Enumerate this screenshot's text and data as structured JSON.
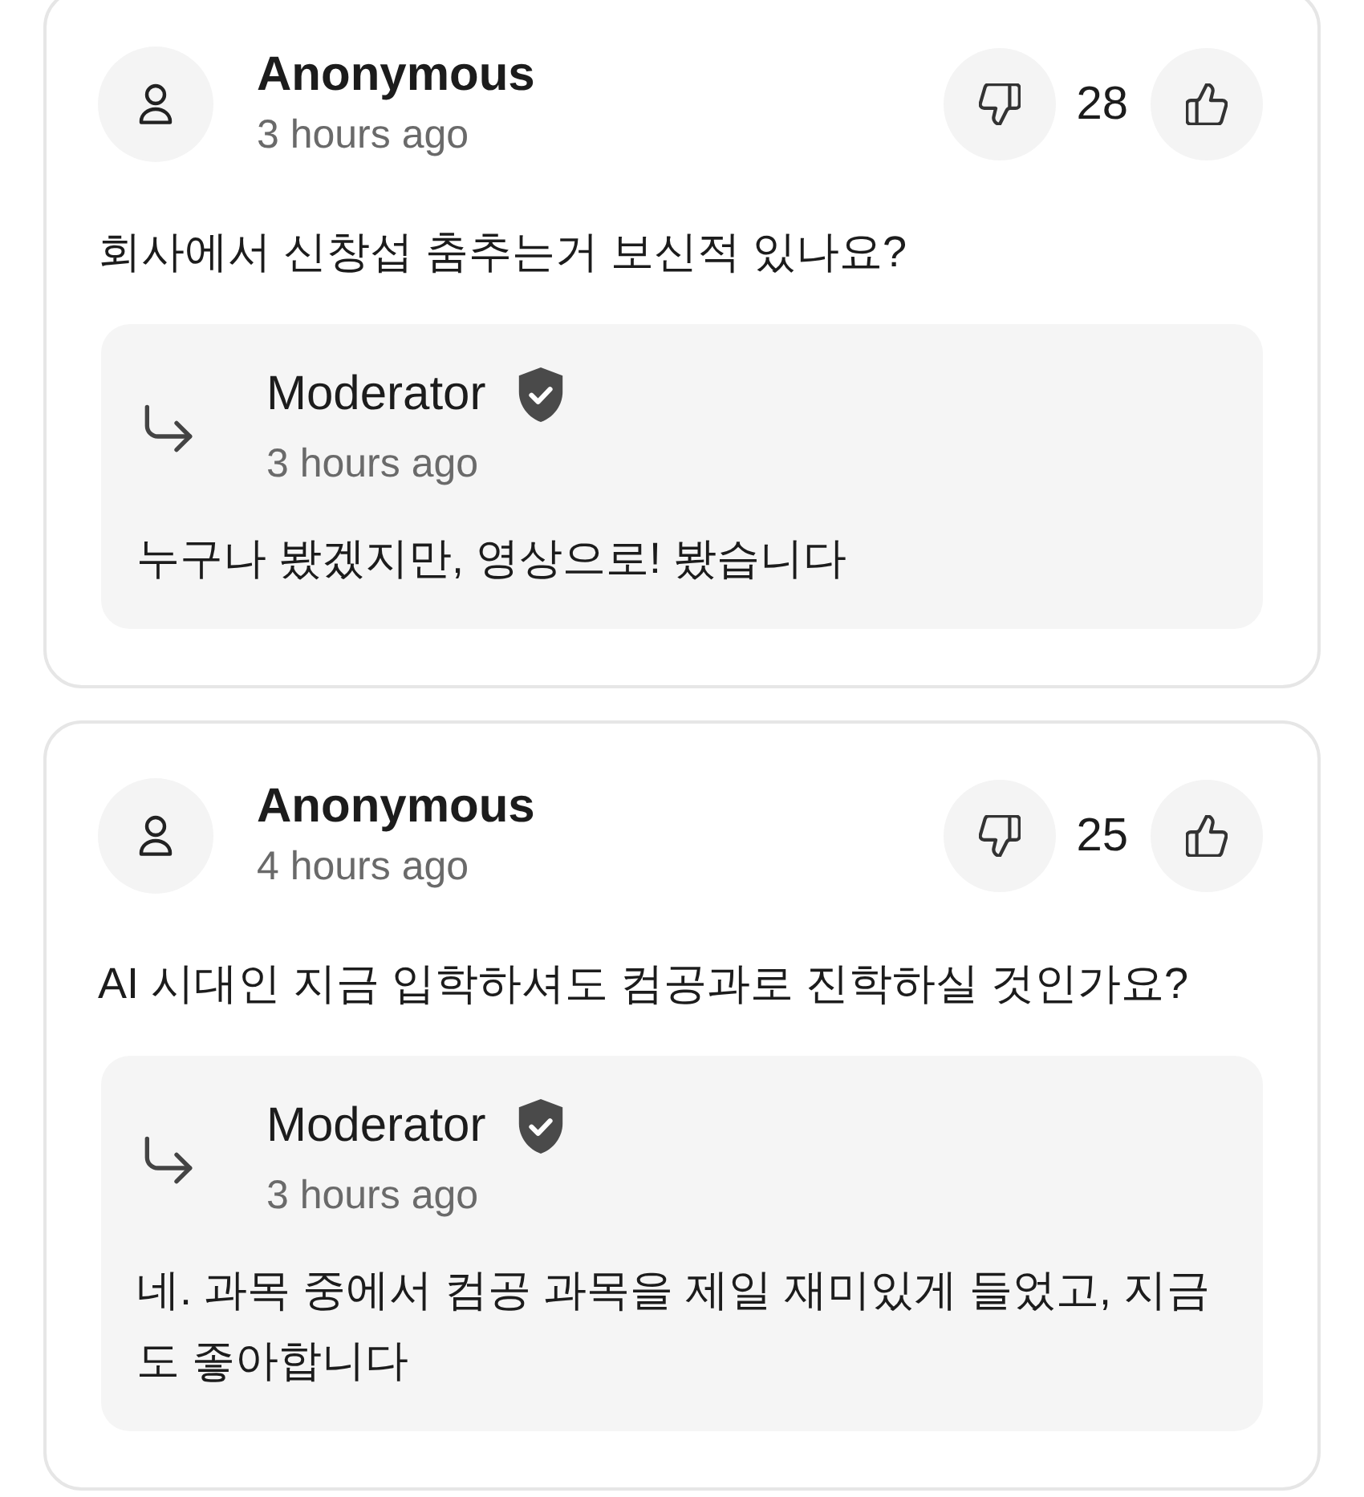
{
  "comments": [
    {
      "author": "Anonymous",
      "time": "3 hours ago",
      "score": "28",
      "text": "회사에서 신창섭 춤추는거 보신적 있나요?",
      "reply": {
        "author": "Moderator",
        "verified": true,
        "time": "3 hours ago",
        "text": "누구나 봤겠지만, 영상으로! 봤습니다"
      }
    },
    {
      "author": "Anonymous",
      "time": "4 hours ago",
      "score": "25",
      "text": "AI 시대인 지금 입학하셔도 컴공과로 진학하실 것인가요?",
      "reply": {
        "author": "Moderator",
        "verified": true,
        "time": "3 hours ago",
        "text": "네. 과목 중에서 컴공 과목을 제일 재미있게 들었고, 지금도 좋아합니다"
      }
    }
  ]
}
